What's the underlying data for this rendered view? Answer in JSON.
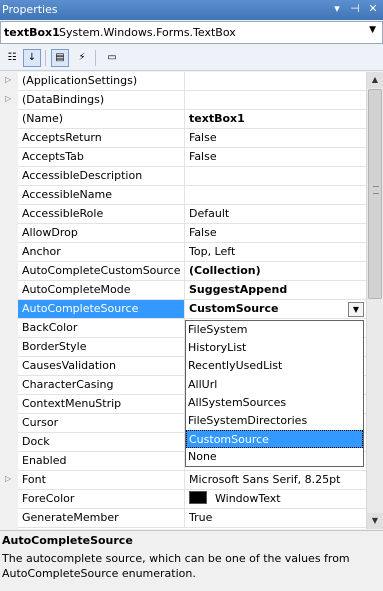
{
  "window": {
    "title": "Properties",
    "pin_icon": "pin-icon",
    "close_icon": "close-icon",
    "menu_icon": "dropdown-arrow-icon"
  },
  "object_selector": {
    "name": "textBox1",
    "type": "System.Windows.Forms.TextBox"
  },
  "toolbar": {
    "buttons": [
      "categorized-icon",
      "alphabetical-icon",
      "properties-icon",
      "events-icon",
      "property-pages-icon"
    ]
  },
  "properties": [
    {
      "name": "(ApplicationSettings)",
      "value": "",
      "expandable": true
    },
    {
      "name": "(DataBindings)",
      "value": "",
      "expandable": true
    },
    {
      "name": "(Name)",
      "value": "textBox1",
      "bold": true
    },
    {
      "name": "AcceptsReturn",
      "value": "False"
    },
    {
      "name": "AcceptsTab",
      "value": "False"
    },
    {
      "name": "AccessibleDescription",
      "value": ""
    },
    {
      "name": "AccessibleName",
      "value": ""
    },
    {
      "name": "AccessibleRole",
      "value": "Default"
    },
    {
      "name": "AllowDrop",
      "value": "False"
    },
    {
      "name": "Anchor",
      "value": "Top, Left"
    },
    {
      "name": "AutoCompleteCustomSource",
      "value": "(Collection)",
      "bold": true
    },
    {
      "name": "AutoCompleteMode",
      "value": "SuggestAppend",
      "bold": true
    },
    {
      "name": "AutoCompleteSource",
      "value": "CustomSource",
      "bold": true,
      "selected": true
    },
    {
      "name": "BackColor",
      "value": ""
    },
    {
      "name": "BorderStyle",
      "value": ""
    },
    {
      "name": "CausesValidation",
      "value": ""
    },
    {
      "name": "CharacterCasing",
      "value": ""
    },
    {
      "name": "ContextMenuStrip",
      "value": ""
    },
    {
      "name": "Cursor",
      "value": ""
    },
    {
      "name": "Dock",
      "value": ""
    },
    {
      "name": "Enabled",
      "value": ""
    },
    {
      "name": "Font",
      "value": "Microsoft Sans Serif, 8.25pt",
      "expandable": true
    },
    {
      "name": "ForeColor",
      "value": "WindowText",
      "swatch": "#000000"
    },
    {
      "name": "GenerateMember",
      "value": "True"
    }
  ],
  "dropdown": {
    "options": [
      "FileSystem",
      "HistoryList",
      "RecentlyUsedList",
      "AllUrl",
      "AllSystemSources",
      "FileSystemDirectories",
      "CustomSource",
      "None"
    ],
    "selected_index": 6
  },
  "description": {
    "title": "AutoCompleteSource",
    "text": "The autocomplete source, which can be one of the values from AutoCompleteSource enumeration."
  },
  "colors": {
    "selection": "#3399ff",
    "titlebar": "#4a7fc0"
  }
}
